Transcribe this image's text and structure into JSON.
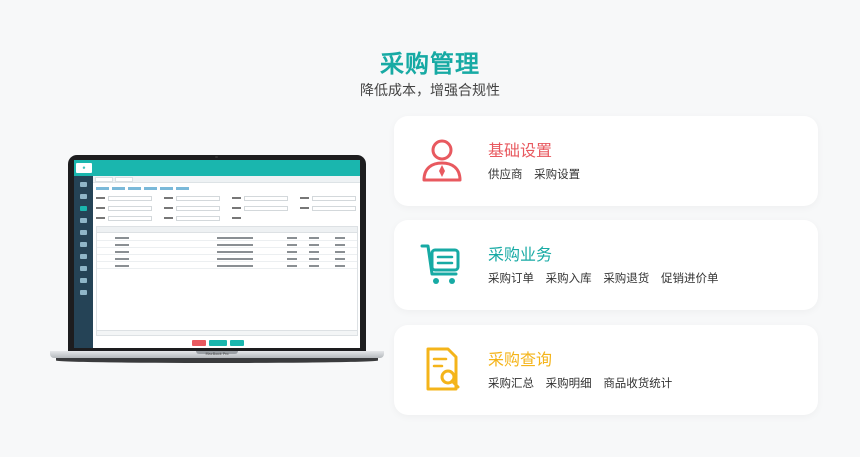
{
  "header": {
    "title": "采购管理",
    "subtitle": "降低成本，增强合规性"
  },
  "laptop": {
    "model_label": "MacBook Pro",
    "app_logo": "e"
  },
  "cards": [
    {
      "title": "基础设置",
      "color": "#e8595f",
      "icon": "user-tie-icon",
      "items": [
        "供应商",
        "采购设置"
      ]
    },
    {
      "title": "采购业务",
      "color": "#17aaa4",
      "icon": "cart-list-icon",
      "items": [
        "采购订单",
        "采购入库",
        "采购退货",
        "促销进价单"
      ]
    },
    {
      "title": "采购查询",
      "color": "#f4b41a",
      "icon": "document-search-icon",
      "items": [
        "采购汇总",
        "采购明细",
        "商品收货统计"
      ]
    }
  ]
}
